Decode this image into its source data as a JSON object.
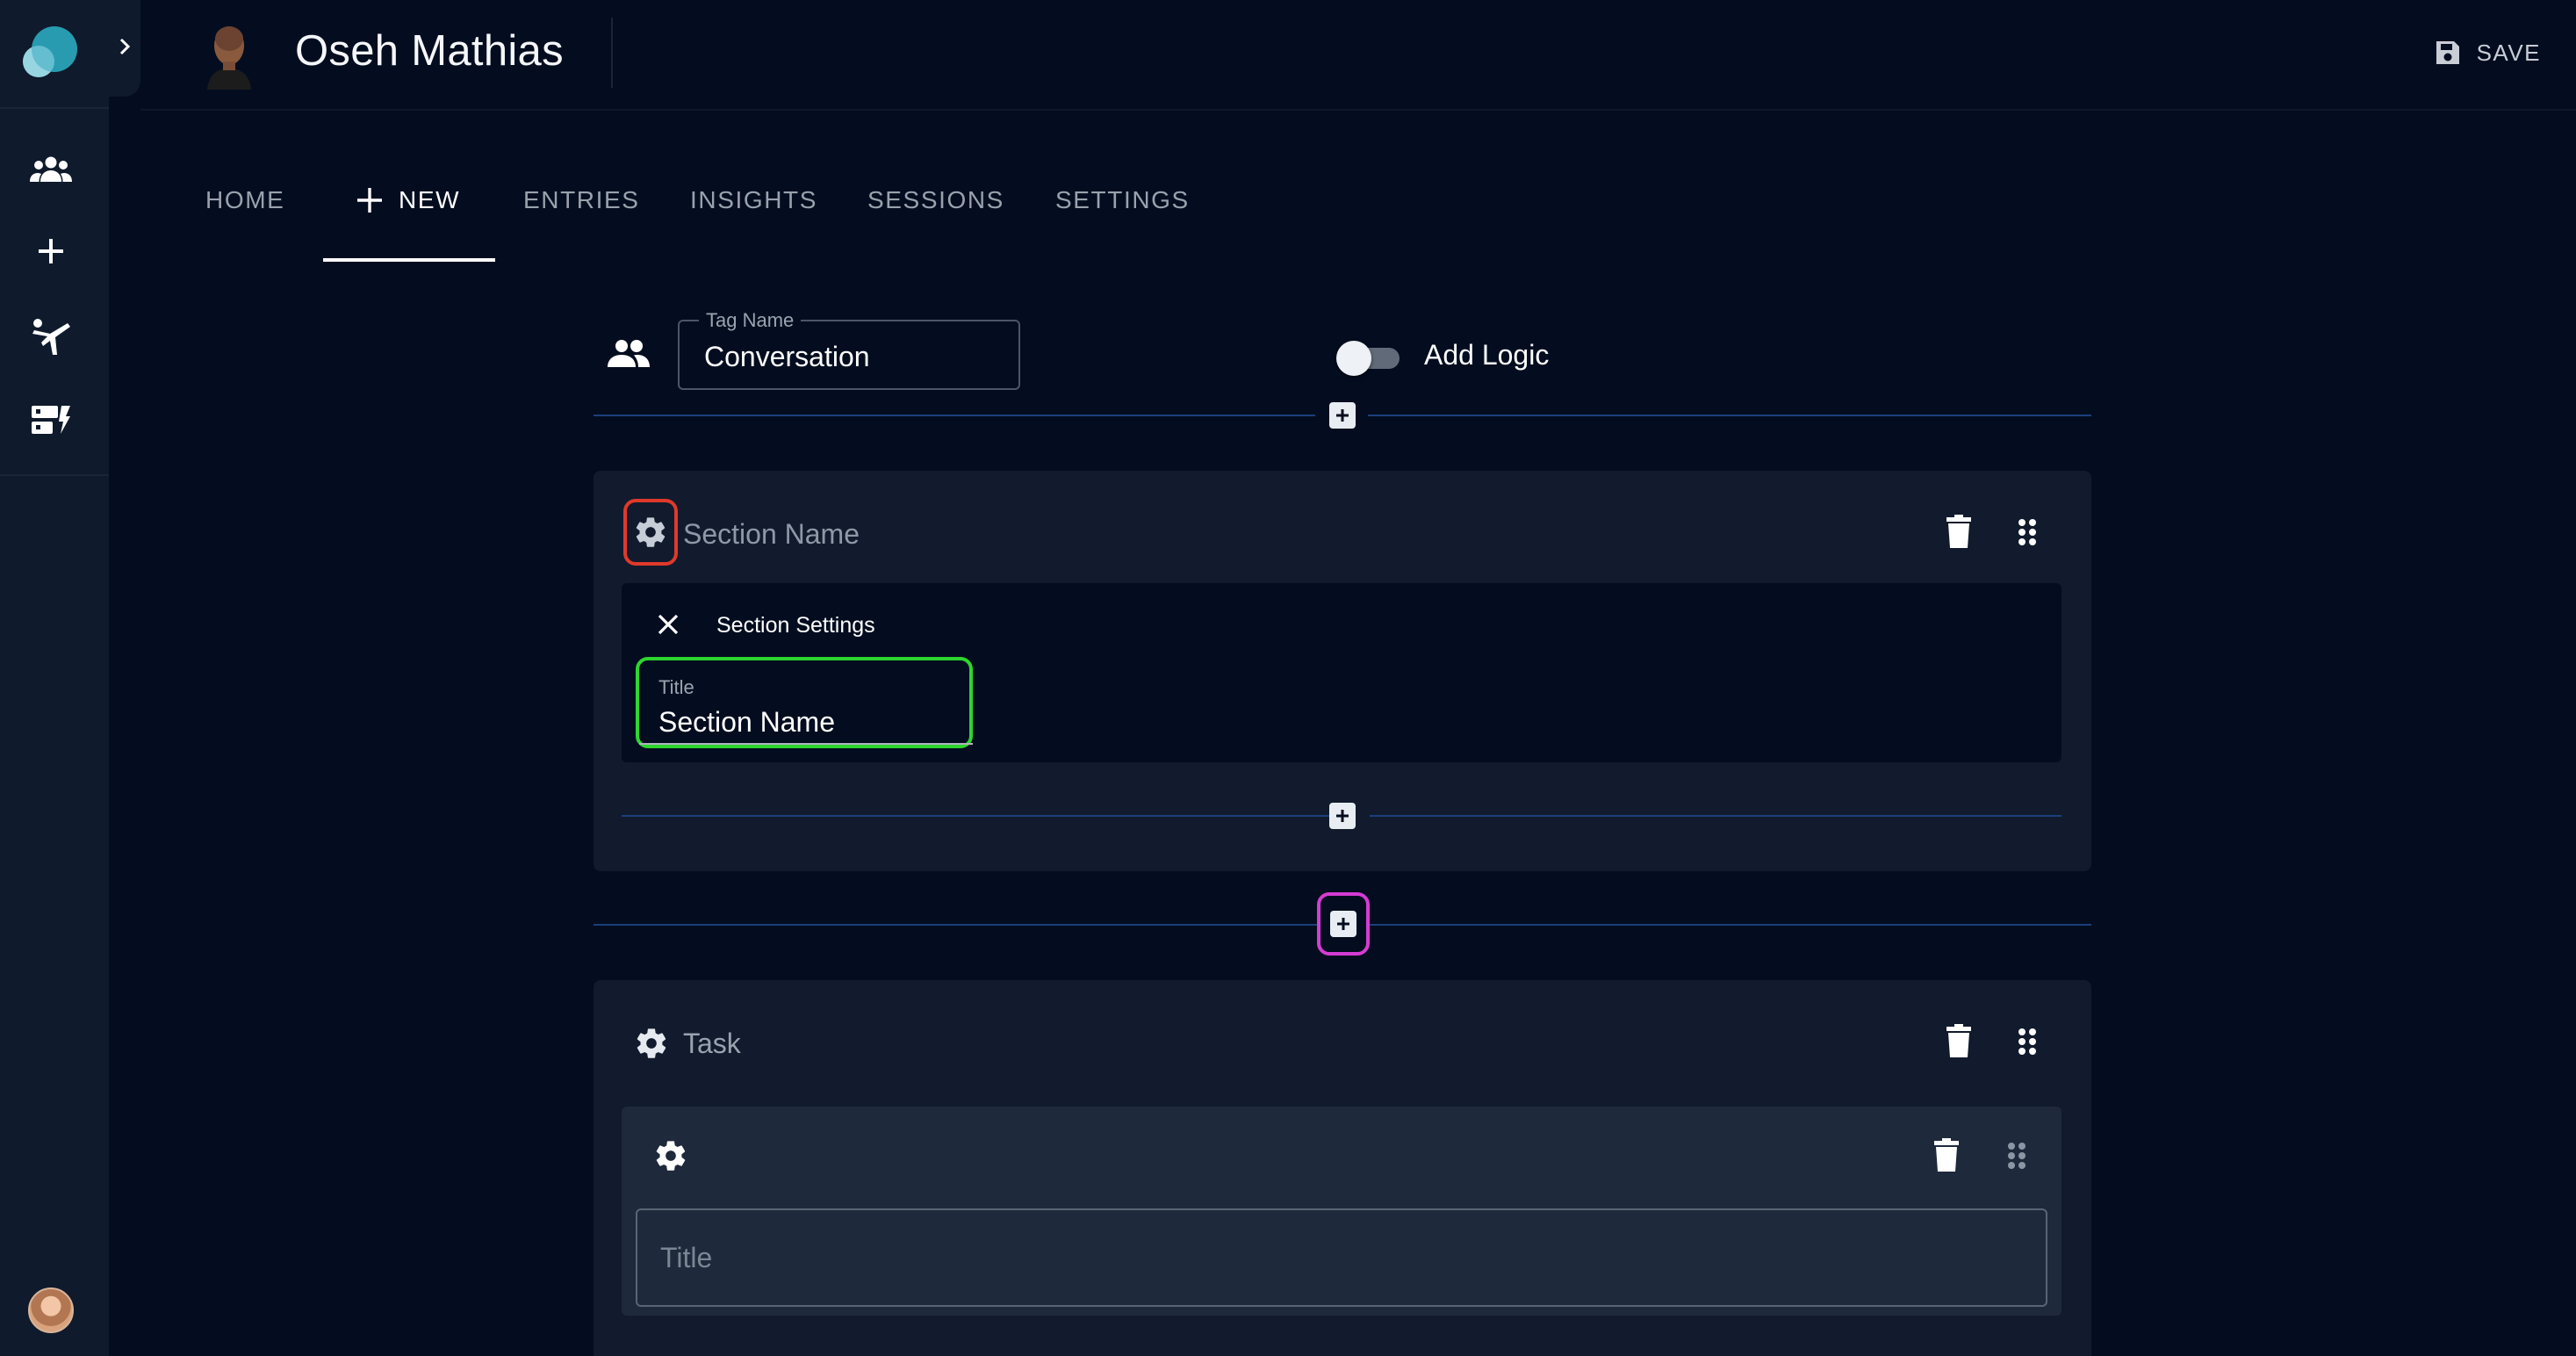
{
  "header": {
    "user_name": "Oseh Mathias",
    "save_label": "SAVE"
  },
  "tabs": [
    {
      "label": "HOME"
    },
    {
      "label": "NEW",
      "active": true
    },
    {
      "label": "ENTRIES"
    },
    {
      "label": "INSIGHTS"
    },
    {
      "label": "SESSIONS"
    },
    {
      "label": "SETTINGS"
    }
  ],
  "sidebar": {
    "icons": [
      "group-icon",
      "plus-icon",
      "martial-arts-icon",
      "dashboard-flash-icon"
    ]
  },
  "tag": {
    "label": "Tag Name",
    "value": "Conversation"
  },
  "logic_toggle": {
    "label": "Add Logic",
    "on": false
  },
  "section": {
    "name_placeholder": "Section Name",
    "settings_title": "Section Settings",
    "title_label": "Title",
    "title_value": "Section Name"
  },
  "task": {
    "name": "Task",
    "title_placeholder": "Title"
  },
  "colors": {
    "background": "#030d1f",
    "card": "#111b2d",
    "divider": "#1b3f7c",
    "highlight_red": "#e0392b",
    "highlight_green": "#2ed52e",
    "highlight_magenta": "#d63bd4"
  }
}
